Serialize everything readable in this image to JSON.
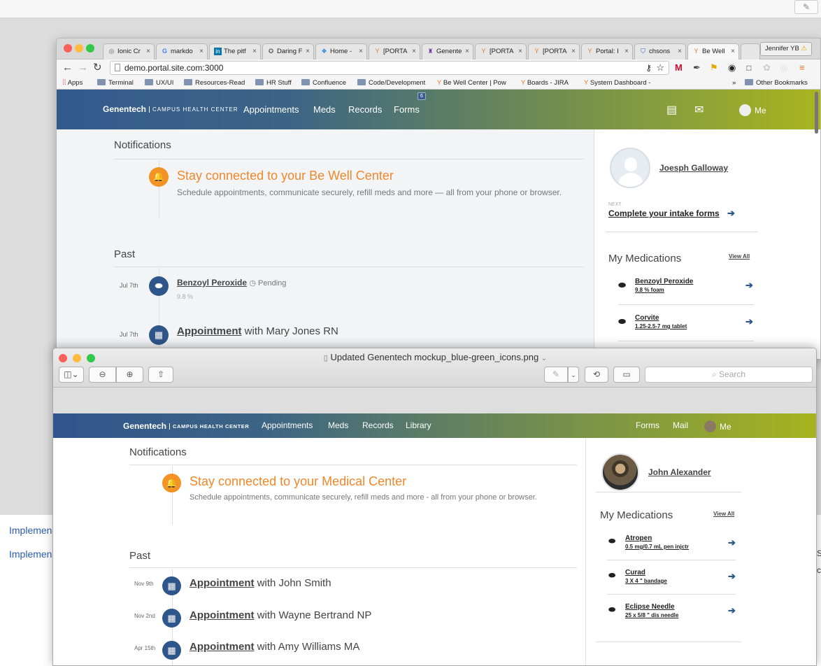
{
  "browser": {
    "tabs": [
      {
        "label": "Ionic Cr",
        "icon": "globe-icon"
      },
      {
        "label": "markdo",
        "icon": "google-icon"
      },
      {
        "label": "The pitf",
        "icon": "linkedin-icon"
      },
      {
        "label": "Daring F",
        "icon": "star-icon"
      },
      {
        "label": "Home -",
        "icon": "dropbox-icon"
      },
      {
        "label": "[PORTA",
        "icon": "fork-icon"
      },
      {
        "label": "Genente",
        "icon": "robot-icon"
      },
      {
        "label": "[PORTA",
        "icon": "fork-icon"
      },
      {
        "label": "[PORTA",
        "icon": "fork-icon"
      },
      {
        "label": "Portal: I",
        "icon": "fork-icon"
      },
      {
        "label": "chsons",
        "icon": "shield-icon"
      },
      {
        "label": "Be Well",
        "icon": "fork-icon"
      }
    ],
    "user_chip": "Jennifer YB",
    "url": "demo.portal.site.com:3000",
    "bookmarks": [
      "Apps",
      "Terminal",
      "UX/UI",
      "Resources-Read",
      "HR Stuff",
      "Confluence",
      "Code/Development",
      "Be Well Center | Pow",
      "Boards - JIRA",
      "System Dashboard -",
      "»",
      "Other Bookmarks"
    ]
  },
  "site": {
    "brand": "Genentech",
    "brand_sub": "CAMPUS HEALTH CENTER",
    "nav": [
      "Appointments",
      "Meds",
      "Records",
      "Forms"
    ],
    "forms_badge": "6",
    "me": "Me",
    "notifications_title": "Notifications",
    "notif_title": "Stay connected to your Be Well Center",
    "notif_body": "Schedule appointments, communicate securely, refill meds and more — all from your phone or browser.",
    "past_title": "Past",
    "past": [
      {
        "date": "Jul 7th",
        "link": "Benzoyl Peroxide",
        "status": "Pending",
        "detail": "9.8 %"
      },
      {
        "date": "Jul 7th",
        "link": "Appointment",
        "rest": "with Mary Jones RN"
      }
    ],
    "user_name": "Joesph Galloway",
    "next_label": "NEXT",
    "next_link": "Complete your intake forms",
    "medications_title": "My Medications",
    "view_all": "View All",
    "meds": [
      {
        "name": "Benzoyl Peroxide",
        "desc": "9.8 % foam"
      },
      {
        "name": "Corvite",
        "desc": "1.25-2.5-7 mg tablet"
      }
    ]
  },
  "preview": {
    "title": "Updated Genentech mockup_blue-green_icons.png",
    "search_placeholder": "Search",
    "brand": "Genentech",
    "brand_sub": "CAMPUS HEALTH CENTER",
    "nav": [
      "Appointments",
      "Meds",
      "Records",
      "Library"
    ],
    "right_nav": [
      "Forms",
      "Mail",
      "Me"
    ],
    "notifications_title": "Notifications",
    "notif_title": "Stay connected to your Medical Center",
    "notif_body": "Schedule appointments, communicate securely, refill meds and more - all from your phone or browser.",
    "past_title": "Past",
    "past": [
      {
        "date": "Nov 9th",
        "link": "Appointment",
        "rest": "with John Smith"
      },
      {
        "date": "Nov 2nd",
        "link": "Appointment",
        "rest": "with Wayne Bertrand NP"
      },
      {
        "date": "Apr 15th",
        "link": "Appointment",
        "rest": "with Amy Williams MA"
      }
    ],
    "user_name": "John Alexander",
    "medications_title": "My Medications",
    "view_all": "View All",
    "meds": [
      {
        "name": "Atropen",
        "desc": "0.5 mg/0.7 mL pen injctr"
      },
      {
        "name": "Curad",
        "desc": "3 X 4 \" bandage"
      },
      {
        "name": "Eclipse Needle",
        "desc": "25 x 5/8 \" dis needle"
      }
    ]
  },
  "desktop": {
    "links": [
      "Implemen",
      "Implemen"
    ],
    "edge_text": [
      "S",
      "c"
    ]
  }
}
